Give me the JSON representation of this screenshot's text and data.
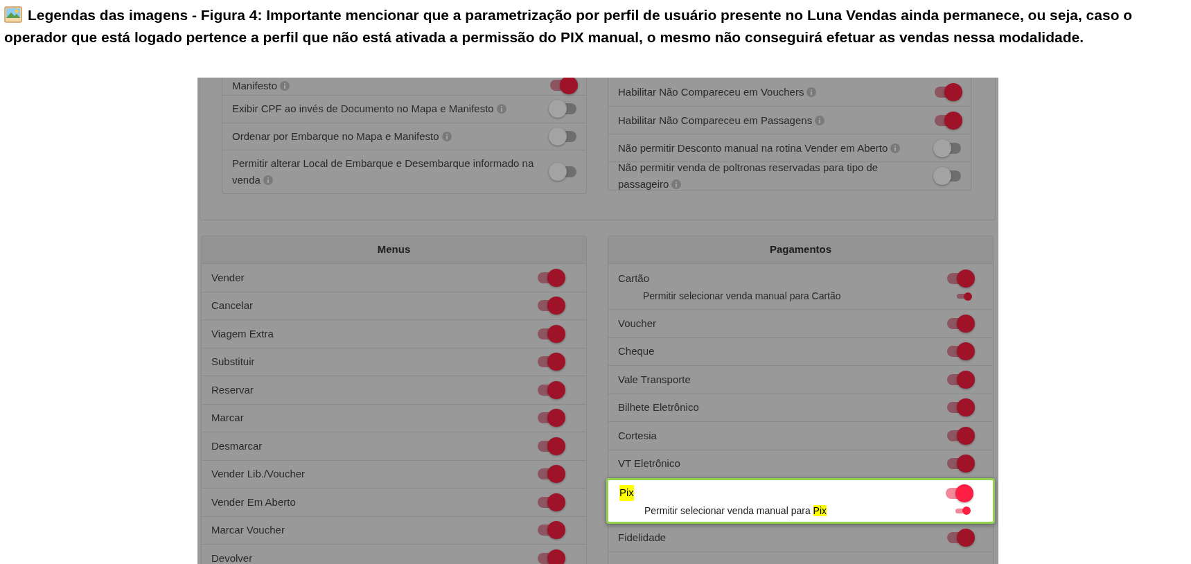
{
  "caption": {
    "text": "Legendas das imagens - Figura 4: Importante mencionar que a parametrização por perfil de usuário presente no Luna Vendas ainda permanece, ou seja, caso o operador que está logado pertence a perfil que não está ativada a permissão do PIX manual, o mesmo não conseguirá efetuar as vendas nessa modalidade."
  },
  "settings_left": [
    {
      "label": "Manifesto",
      "info": true,
      "on": true
    },
    {
      "label": "Exibir CPF ao invés de Documento no Mapa e Manifesto",
      "info": true,
      "on": false
    },
    {
      "label": "Ordenar por Embarque no Mapa e Manifesto",
      "info": true,
      "on": false
    },
    {
      "label": "Permitir alterar Local de Embarque e Desembarque informado na venda",
      "info": true,
      "on": false
    }
  ],
  "settings_right": [
    {
      "label": "Habilitar Não Compareceu em Vouchers",
      "info": true,
      "on": true
    },
    {
      "label": "Habilitar Não Compareceu em Passagens",
      "info": true,
      "on": true
    },
    {
      "label": "Não permitir Desconto manual na rotina Vender em Aberto",
      "info": true,
      "on": false
    },
    {
      "label": "Não permitir venda de poltronas reservadas para tipo de passageiro",
      "info": true,
      "on": false
    }
  ],
  "menus": {
    "title": "Menus",
    "items": [
      {
        "label": "Vender",
        "on": true
      },
      {
        "label": "Cancelar",
        "on": true
      },
      {
        "label": "Viagem Extra",
        "on": true
      },
      {
        "label": "Substituir",
        "on": true
      },
      {
        "label": "Reservar",
        "on": true
      },
      {
        "label": "Marcar",
        "on": true
      },
      {
        "label": "Desmarcar",
        "on": true
      },
      {
        "label": "Vender Lib./Voucher",
        "on": true
      },
      {
        "label": "Vender Em Aberto",
        "on": true
      },
      {
        "label": "Marcar Voucher",
        "on": true
      },
      {
        "label": "Devolver",
        "on": true
      }
    ]
  },
  "payments": {
    "title": "Pagamentos",
    "items": [
      {
        "label": "Cartão",
        "on": true,
        "highlighted": false,
        "sub": {
          "on": true,
          "segments": [
            {
              "text": "Permitir selecionar venda manual para Cartão",
              "highlighted": false
            }
          ]
        }
      },
      {
        "label": "Voucher",
        "on": true,
        "highlighted": false
      },
      {
        "label": "Cheque",
        "on": true,
        "highlighted": false
      },
      {
        "label": "Vale Transporte",
        "on": true,
        "highlighted": false
      },
      {
        "label": "Bilhete Eletrônico",
        "on": true,
        "highlighted": false
      },
      {
        "label": "Cortesia",
        "on": true,
        "highlighted": false
      },
      {
        "label": "VT Eletrônico",
        "on": true,
        "highlighted": false
      },
      {
        "label": "Pix",
        "on": true,
        "highlighted": true,
        "sub": {
          "on": true,
          "segments": [
            {
              "text": "Permitir selecionar venda manual para ",
              "highlighted": false
            },
            {
              "text": "Pix",
              "highlighted": true
            }
          ]
        }
      },
      {
        "label": "Fidelidade",
        "on": true,
        "highlighted": false
      }
    ]
  }
}
